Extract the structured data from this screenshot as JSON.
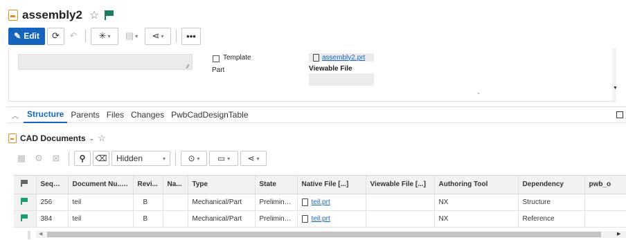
{
  "header": {
    "title": "assembly2",
    "star_icon": "star-outline-icon",
    "flag_color": "#1a7f5a"
  },
  "toolbar": {
    "edit_label": "Edit",
    "accent": "#1565c0"
  },
  "form": {
    "template_label": "Template",
    "part_label": "Part",
    "viewable_file_link": "assembly2.prt",
    "viewable_file_label": "Viewable File"
  },
  "tabs": [
    {
      "label": "Structure",
      "active": true
    },
    {
      "label": "Parents"
    },
    {
      "label": "Files"
    },
    {
      "label": "Changes"
    },
    {
      "label": "PwbCadDesignTable"
    }
  ],
  "section": {
    "title": "CAD Documents"
  },
  "table_toolbar": {
    "filter_value": "Hidden"
  },
  "table": {
    "columns": [
      "Seque...",
      "Document Nu...",
      "Revi...",
      "Na...",
      "Type",
      "State",
      "Native File [...]",
      "Viewable File [...]",
      "Authoring Tool",
      "Dependency",
      "pwb_o"
    ],
    "rows": [
      {
        "seq": "256",
        "doc": "teil",
        "rev": "B",
        "name": "",
        "type": "Mechanical/Part",
        "state": "Preliminary",
        "native": "teil.prt",
        "viewable": "",
        "tool": "NX",
        "dependency": "Structure",
        "pwb": ""
      },
      {
        "seq": "384",
        "doc": "teil",
        "rev": "B",
        "name": "",
        "type": "Mechanical/Part",
        "state": "Preliminary",
        "native": "teil.prt",
        "viewable": "",
        "tool": "NX",
        "dependency": "Reference",
        "pwb": ""
      }
    ]
  }
}
